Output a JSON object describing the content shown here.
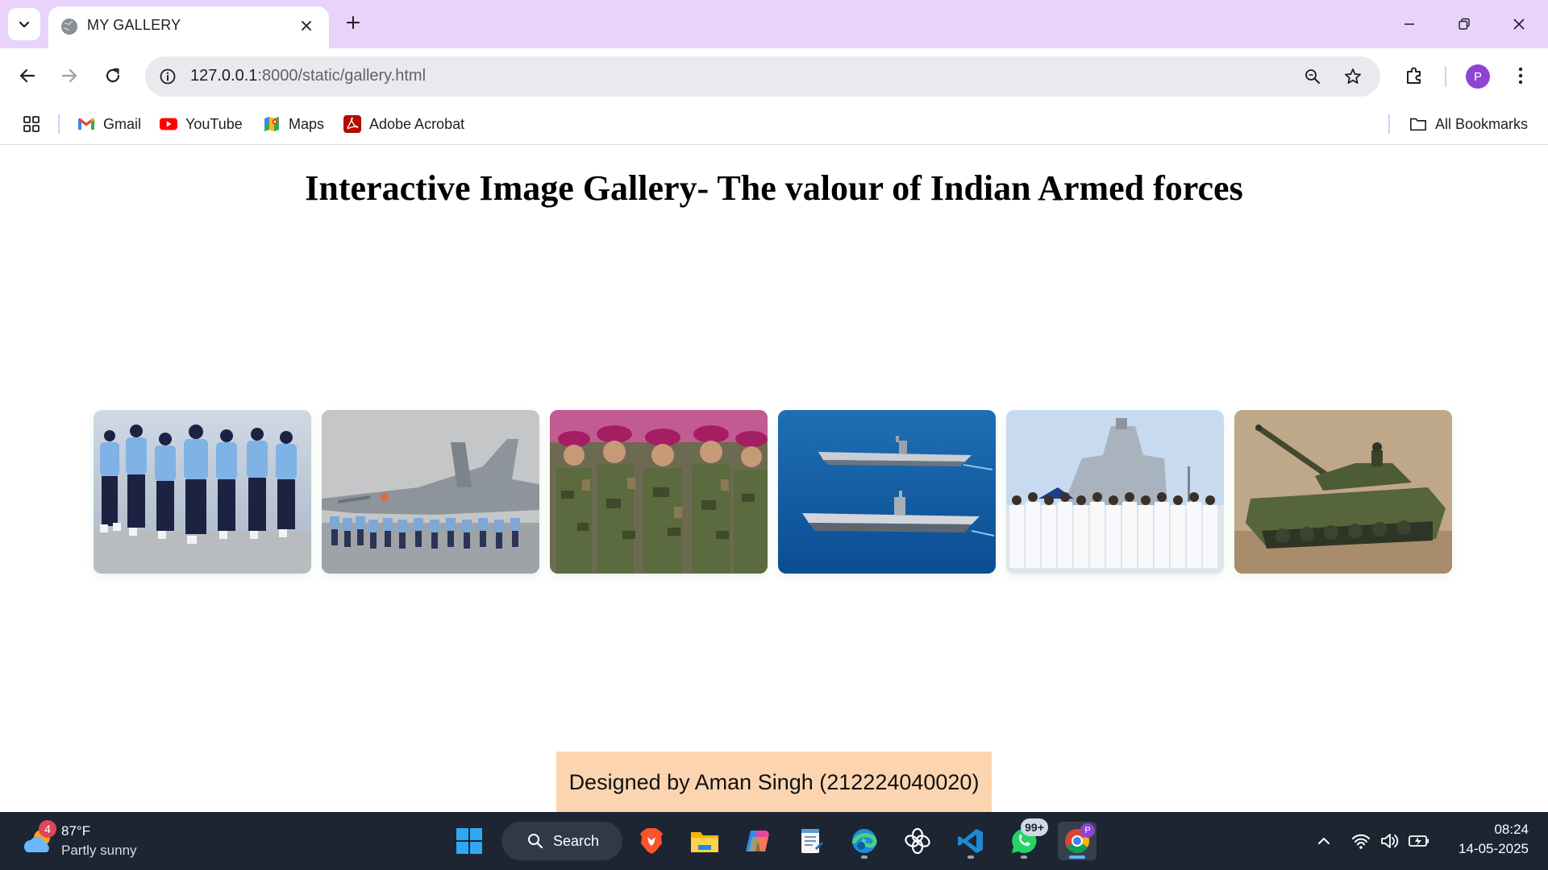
{
  "browser": {
    "tab": {
      "title": "MY GALLERY"
    },
    "address": {
      "host": "127.0.0.1",
      "path": ":8000/static/gallery.html"
    },
    "bookmarks": [
      {
        "label": "Gmail",
        "icon": "gmail-icon"
      },
      {
        "label": "YouTube",
        "icon": "youtube-icon"
      },
      {
        "label": "Maps",
        "icon": "maps-icon"
      },
      {
        "label": "Adobe Acrobat",
        "icon": "acrobat-icon"
      }
    ],
    "all_bookmarks_label": "All Bookmarks",
    "profile_initial": "P"
  },
  "page": {
    "title": "Interactive Image Gallery- The valour of Indian Armed forces",
    "gallery": [
      {
        "subject": "air-force-parade"
      },
      {
        "subject": "fighter-jet-parade"
      },
      {
        "subject": "army-parade"
      },
      {
        "subject": "aircraft-carriers"
      },
      {
        "subject": "navy-personnel"
      },
      {
        "subject": "army-tank"
      }
    ],
    "footer": "Designed by Aman Singh (212224040020)"
  },
  "taskbar": {
    "weather": {
      "badge": "4",
      "temp": "87°F",
      "desc": "Partly sunny"
    },
    "search_label": "Search",
    "whatsapp_badge": "99+",
    "chrome_profile_initial": "P",
    "clock": {
      "time": "08:24",
      "date": "14-05-2025"
    }
  },
  "colors": {
    "titlebar": "#e9d3fb",
    "accent": "#8e44d2",
    "footer_bg": "#fcd5b0",
    "taskbar": "#1c2531"
  }
}
